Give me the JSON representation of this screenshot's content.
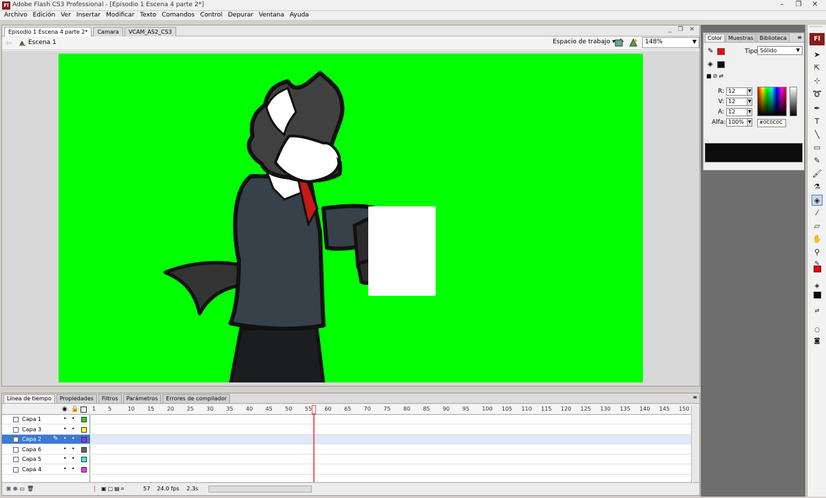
{
  "window": {
    "title": "Adobe Flash CS3 Professional - [Episodio 1 Escena 4 parte 2*]",
    "app_icon_label": "Fl",
    "min": "–",
    "max": "❐",
    "close": "✕"
  },
  "menu": [
    "Archivo",
    "Edición",
    "Ver",
    "Insertar",
    "Modificar",
    "Texto",
    "Comandos",
    "Control",
    "Depurar",
    "Ventana",
    "Ayuda"
  ],
  "doc_tabs": [
    {
      "label": "Episodio 1 Escena 4 parte 2*",
      "active": true
    },
    {
      "label": "Camara",
      "active": false
    },
    {
      "label": "VCAM_AS2_CS3",
      "active": false
    }
  ],
  "edit_bar": {
    "scene": "Escena 1",
    "workspace": "Espacio de trabajo",
    "zoom": "148%"
  },
  "stage": {
    "background": "#00ff00"
  },
  "color_panel": {
    "tabs": [
      {
        "label": "Color",
        "active": true
      },
      {
        "label": "Muestras",
        "active": false
      },
      {
        "label": "Biblioteca",
        "active": false
      }
    ],
    "tipo_label": "Tipo:",
    "tipo_value": "Sólido",
    "r_label": "R:",
    "r": "12",
    "v_label": "V:",
    "v": "12",
    "a_label": "A:",
    "a": "12",
    "alfa_label": "Alfa:",
    "alfa": "100%",
    "hex": "#0C0C0C",
    "stroke_color": "#ff0000",
    "fill_color": "#0c0c0c"
  },
  "toolbar": {
    "logo": "Fl",
    "tools": [
      "selection-icon",
      "subselection-icon",
      "free-transform-icon",
      "lasso-icon",
      "pen-icon",
      "text-icon",
      "line-icon",
      "rectangle-icon",
      "pencil-icon",
      "brush-icon",
      "ink-bottle-icon",
      "paint-bucket-icon",
      "eyedropper-icon",
      "eraser-icon",
      "hand-icon",
      "zoom-icon"
    ]
  },
  "timeline": {
    "tabs": [
      {
        "label": "Línea de tiempo",
        "active": true
      },
      {
        "label": "Propiedades",
        "active": false
      },
      {
        "label": "Filtros",
        "active": false
      },
      {
        "label": "Parámetros",
        "active": false
      },
      {
        "label": "Errores de compilador",
        "active": false
      }
    ],
    "layers": [
      {
        "name": "Capa 1",
        "color": "#33cc33",
        "selected": false
      },
      {
        "name": "Capa 3",
        "color": "#ffff33",
        "selected": false
      },
      {
        "name": "Capa 2",
        "color": "#9933ff",
        "selected": true
      },
      {
        "name": "Capa 6",
        "color": "#666666",
        "selected": false
      },
      {
        "name": "Capa 5",
        "color": "#33ffff",
        "selected": false
      },
      {
        "name": "Capa 4",
        "color": "#ff33ff",
        "selected": false
      }
    ],
    "ruler": [
      "1",
      "5",
      "10",
      "15",
      "20",
      "25",
      "30",
      "35",
      "40",
      "45",
      "50",
      "55",
      "60",
      "65",
      "70",
      "75",
      "80",
      "85",
      "90",
      "95",
      "100",
      "105",
      "110",
      "115",
      "120",
      "125",
      "130",
      "135",
      "140",
      "145",
      "150"
    ],
    "playhead_frame": 57,
    "status": {
      "frame": "57",
      "fps": "24.0 fps",
      "time": "2.3s"
    }
  }
}
